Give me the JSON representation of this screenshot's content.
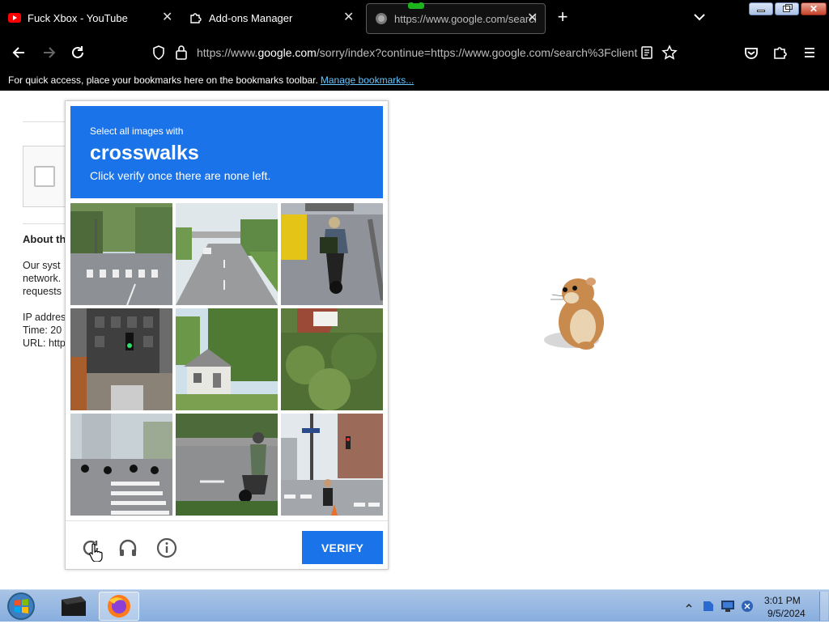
{
  "browser": {
    "tabs": [
      {
        "title": "Fuck Xbox - YouTube",
        "favicon": "youtube-icon"
      },
      {
        "title": "Add-ons Manager",
        "favicon": "puzzle-icon"
      },
      {
        "title": "https://www.google.com/search",
        "favicon": "globe-icon"
      }
    ],
    "new_tab_label": "+",
    "url_prefix": "https://www.",
    "url_domain": "google.com",
    "url_rest": "/sorry/index?continue=https://www.google.com/search%3Fclient",
    "bookmarks_hint": "For quick access, place your bookmarks here on the bookmarks toolbar.",
    "manage_bookmarks": "Manage bookmarks..."
  },
  "page": {
    "about_heading": "About th",
    "lines": [
      "Our syst",
      "network.",
      "requests",
      "IP addres",
      "Time: 20",
      "URL: http"
    ]
  },
  "captcha": {
    "instruction": "Select all images with",
    "object": "crosswalks",
    "hint": "Click verify once there are none left.",
    "verify_label": "VERIFY",
    "accent": "#1a73e8",
    "tiles": [
      "crosswalk-street",
      "highway",
      "motorcycle-rider",
      "traffic-light",
      "house",
      "bushes",
      "crosswalk-scooters",
      "scooter-road",
      "crosswalk-pedestrian"
    ]
  },
  "taskbar": {
    "time": "3:01 PM",
    "date": "9/5/2024"
  }
}
